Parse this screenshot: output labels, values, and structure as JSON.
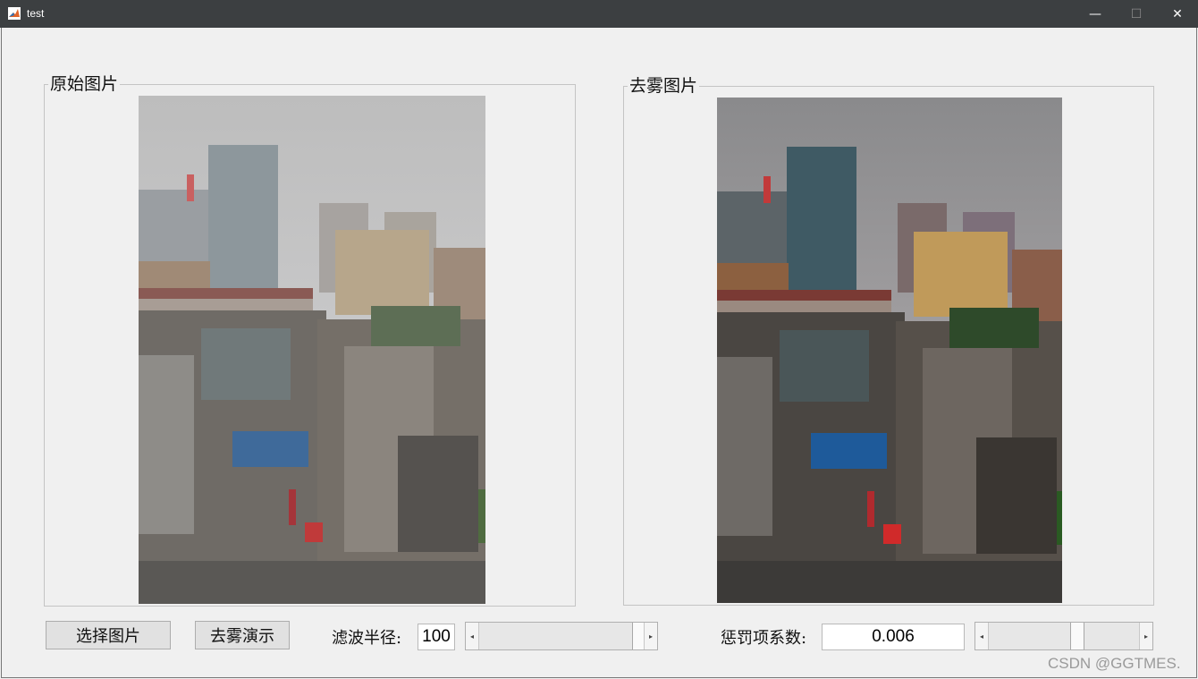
{
  "window": {
    "title": "test",
    "controls": {
      "minimize": "—",
      "maximize": "☐",
      "close": "✕"
    }
  },
  "panels": {
    "original": {
      "title": "原始图片"
    },
    "dehazed": {
      "title": "去雾图片"
    }
  },
  "controls": {
    "select_button": "选择图片",
    "demo_button": "去雾演示",
    "filter_radius_label": "滤波半径:",
    "filter_radius_value": "100",
    "filter_radius_slider_fraction": 0.95,
    "penalty_label": "惩罚项系数:",
    "penalty_value": "0.006",
    "penalty_slider_fraction": 0.55
  },
  "watermark": "CSDN @GGTMES.",
  "colors": {
    "titlebar": "#3c3f41",
    "background": "#f0f0f0",
    "button_face": "#e1e1e1"
  },
  "icons": {
    "app": "matlab-icon",
    "slider_left": "left-arrow-icon",
    "slider_right": "right-arrow-icon"
  }
}
